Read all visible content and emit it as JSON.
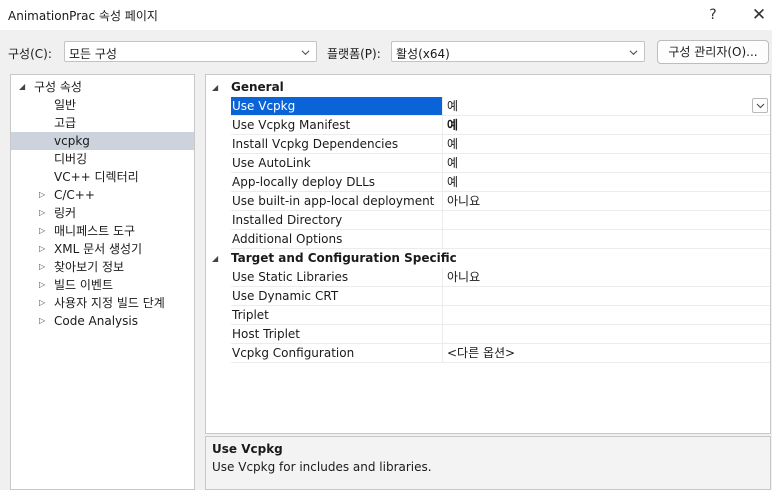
{
  "window": {
    "title": "AnimationPrac 속성 페이지",
    "help_label": "?",
    "close_label": "✕"
  },
  "config": {
    "config_label": "구성(C):",
    "config_value": "모든 구성",
    "platform_label": "플랫폼(P):",
    "platform_value": "활성(x64)",
    "manager_button": "구성 관리자(O)..."
  },
  "tree": {
    "root": "구성 속성",
    "items": [
      {
        "label": "일반",
        "expandable": false
      },
      {
        "label": "고급",
        "expandable": false
      },
      {
        "label": "vcpkg",
        "expandable": false,
        "selected": true
      },
      {
        "label": "디버깅",
        "expandable": false
      },
      {
        "label": "VC++ 디렉터리",
        "expandable": false
      },
      {
        "label": "C/C++",
        "expandable": true
      },
      {
        "label": "링커",
        "expandable": true
      },
      {
        "label": "매니페스트 도구",
        "expandable": true
      },
      {
        "label": "XML 문서 생성기",
        "expandable": true
      },
      {
        "label": "찾아보기 정보",
        "expandable": true
      },
      {
        "label": "빌드 이벤트",
        "expandable": true
      },
      {
        "label": "사용자 지정 빌드 단계",
        "expandable": true
      },
      {
        "label": "Code Analysis",
        "expandable": true
      }
    ]
  },
  "grid": {
    "categories": [
      {
        "name": "General",
        "rows": [
          {
            "name": "Use Vcpkg",
            "value": "예",
            "selected": true
          },
          {
            "name": "Use Vcpkg Manifest",
            "value": "예",
            "bold": true
          },
          {
            "name": "Install Vcpkg Dependencies",
            "value": "예"
          },
          {
            "name": "Use AutoLink",
            "value": "예"
          },
          {
            "name": "App-locally deploy DLLs",
            "value": "예"
          },
          {
            "name": "Use built-in app-local deployment",
            "value": "아니요"
          },
          {
            "name": "Installed Directory",
            "value": ""
          },
          {
            "name": "Additional Options",
            "value": ""
          }
        ]
      },
      {
        "name": "Target and Configuration Specific",
        "rows": [
          {
            "name": "Use Static Libraries",
            "value": "아니요"
          },
          {
            "name": "Use Dynamic CRT",
            "value": ""
          },
          {
            "name": "Triplet",
            "value": ""
          },
          {
            "name": "Host Triplet",
            "value": ""
          },
          {
            "name": "Vcpkg Configuration",
            "value": "<다른 옵션>"
          }
        ]
      }
    ]
  },
  "description": {
    "title": "Use Vcpkg",
    "text": "Use Vcpkg for includes and libraries."
  }
}
